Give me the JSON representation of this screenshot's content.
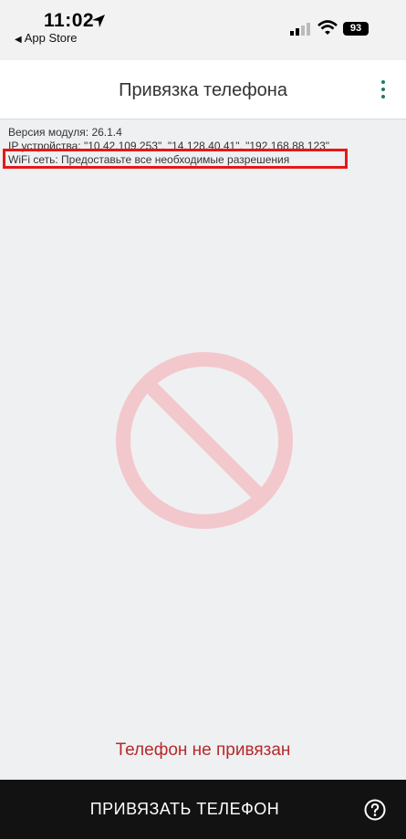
{
  "status_bar": {
    "time": "11:02",
    "back_label": "App Store",
    "battery": "93"
  },
  "header": {
    "title": "Привязка телефона"
  },
  "info": {
    "version": "Версия модуля: 26.1.4",
    "ip": "IP устройства: \"10.42.109.253\", \"14.128.40.41\", \"192.168.88.123\"",
    "wifi": "WiFi сеть: Предоставьте все необходимые разрешения"
  },
  "status": {
    "text": "Телефон не привязан"
  },
  "bottom": {
    "button_label": "ПРИВЯЗАТЬ ТЕЛЕФОН"
  },
  "colors": {
    "accent": "#1e7a6a",
    "status_red": "#b52a2a",
    "highlight": "#e51818",
    "symbol": "#f2c8cc"
  },
  "icons": [
    "location-arrow-icon",
    "back-triangle-icon",
    "cellular-signal-icon",
    "wifi-icon",
    "battery-icon",
    "more-vertical-icon",
    "prohibited-icon",
    "help-icon"
  ]
}
